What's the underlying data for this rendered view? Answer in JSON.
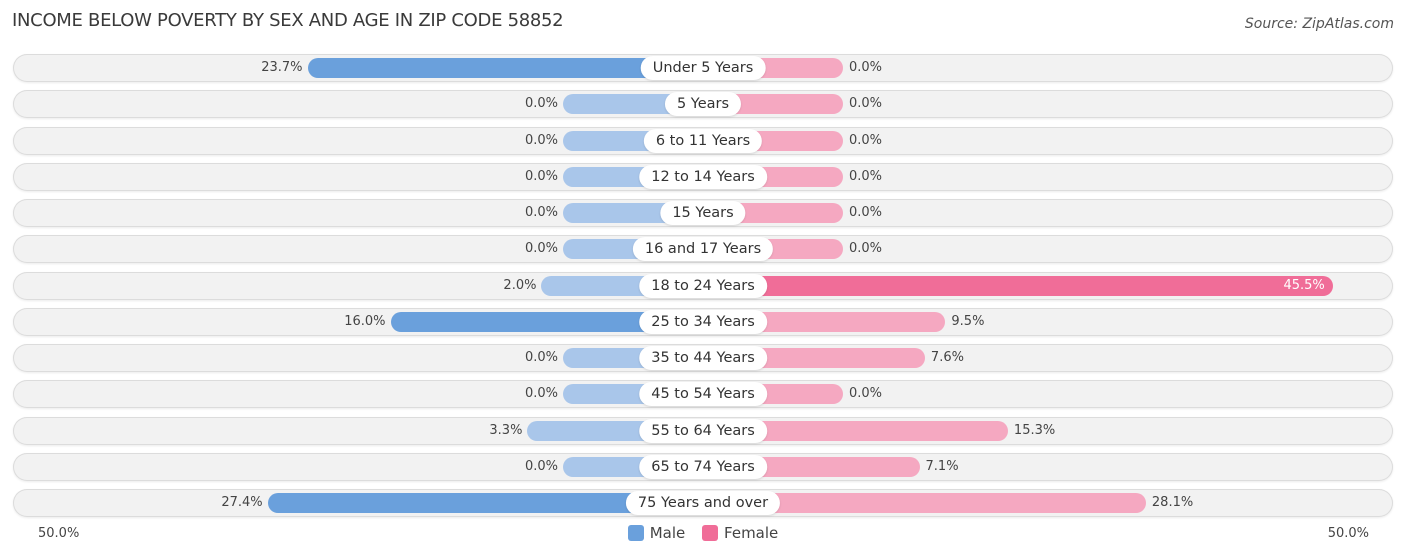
{
  "header": {
    "title": "INCOME BELOW POVERTY BY SEX AND AGE IN ZIP CODE 58852",
    "source": "Source: ZipAtlas.com"
  },
  "colors": {
    "male": "#6aa0dc",
    "male_light": "#a9c6ea",
    "female": "#f06d98",
    "female_light": "#f5a8c1"
  },
  "chart_data": {
    "type": "bar",
    "orientation": "horizontal-diverging",
    "title": "INCOME BELOW POVERTY BY SEX AND AGE IN ZIP CODE 58852",
    "categories": [
      "Under 5 Years",
      "5 Years",
      "6 to 11 Years",
      "12 to 14 Years",
      "15 Years",
      "16 and 17 Years",
      "18 to 24 Years",
      "25 to 34 Years",
      "35 to 44 Years",
      "45 to 54 Years",
      "55 to 64 Years",
      "65 to 74 Years",
      "75 Years and over"
    ],
    "series": [
      {
        "name": "Male",
        "values": [
          23.7,
          0.0,
          0.0,
          0.0,
          0.0,
          0.0,
          2.0,
          16.0,
          0.0,
          0.0,
          3.3,
          0.0,
          27.4
        ]
      },
      {
        "name": "Female",
        "values": [
          0.0,
          0.0,
          0.0,
          0.0,
          0.0,
          0.0,
          45.5,
          9.5,
          7.6,
          0.0,
          15.3,
          7.1,
          28.1
        ]
      }
    ],
    "value_labels": {
      "male": [
        "23.7%",
        "0.0%",
        "0.0%",
        "0.0%",
        "0.0%",
        "0.0%",
        "2.0%",
        "16.0%",
        "0.0%",
        "0.0%",
        "3.3%",
        "0.0%",
        "27.4%"
      ],
      "female": [
        "0.0%",
        "0.0%",
        "0.0%",
        "0.0%",
        "0.0%",
        "0.0%",
        "45.5%",
        "9.5%",
        "7.6%",
        "0.0%",
        "15.3%",
        "7.1%",
        "28.1%"
      ]
    },
    "axis": {
      "left_label": "50.0%",
      "right_label": "50.0%",
      "range": [
        0,
        50
      ]
    },
    "legend": {
      "items": [
        "Male",
        "Female"
      ],
      "position": "bottom-center"
    },
    "grid": false
  }
}
